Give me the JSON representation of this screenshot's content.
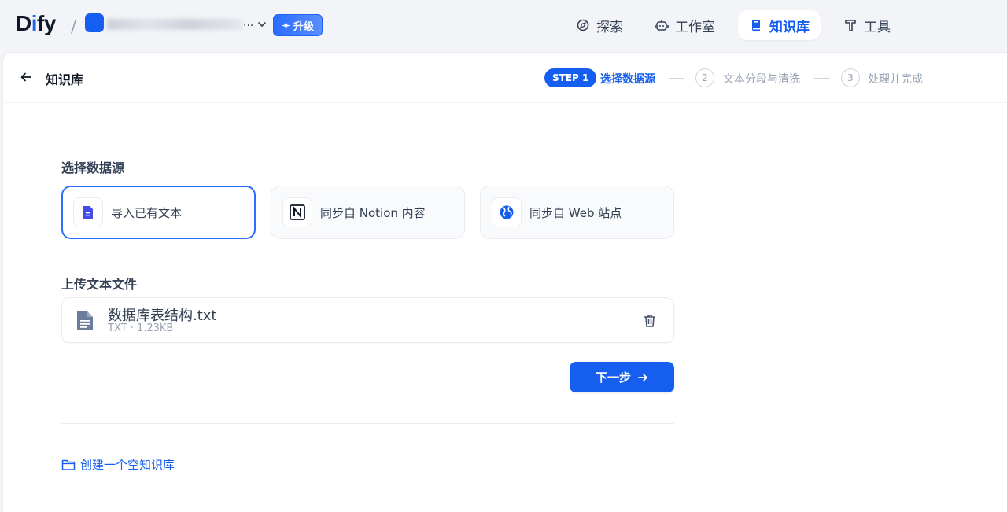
{
  "topbar": {
    "logo_text": "Dify",
    "workspace_ellipsis": "...",
    "upgrade_label": "升级",
    "nav": [
      {
        "label": "探索",
        "icon": "compass-icon"
      },
      {
        "label": "工作室",
        "icon": "robot-icon"
      },
      {
        "label": "知识库",
        "icon": "book-icon",
        "active": true
      },
      {
        "label": "工具",
        "icon": "hammer-icon"
      }
    ]
  },
  "header": {
    "title": "知识库",
    "steps": [
      {
        "badge": "STEP 1",
        "label": "选择数据源",
        "active": true
      },
      {
        "number": "2",
        "label": "文本分段与清洗"
      },
      {
        "number": "3",
        "label": "处理并完成"
      }
    ]
  },
  "main": {
    "datasource_title": "选择数据源",
    "datasources": [
      {
        "label": "导入已有文本",
        "icon": "file-text-icon",
        "selected": true
      },
      {
        "label": "同步自 Notion 内容",
        "icon": "notion-icon"
      },
      {
        "label": "同步自 Web 站点",
        "icon": "globe-icon"
      }
    ],
    "upload_title": "上传文本文件",
    "file": {
      "name": "数据库表结构.txt",
      "meta": "TXT · 1.23KB"
    },
    "next_label": "下一步",
    "empty_link": "创建一个空知识库"
  },
  "colors": {
    "accent": "#155eef",
    "selected_border": "#2970ff"
  }
}
